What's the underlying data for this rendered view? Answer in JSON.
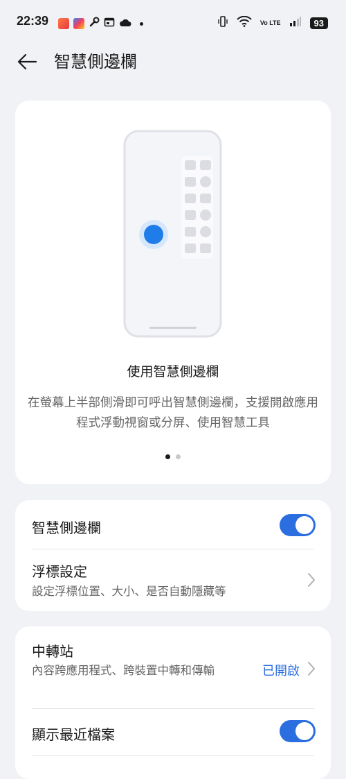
{
  "status_bar": {
    "time": "22:39",
    "network": "Vo LTE",
    "battery": "93",
    "icons": [
      "game-app-icon",
      "photo-app-icon",
      "wrench-icon",
      "calendar-icon",
      "cloud-icon",
      "dot-icon",
      "vibrate-icon",
      "wifi-icon",
      "signal-icon",
      "battery-icon"
    ]
  },
  "header": {
    "title": "智慧側邊欄"
  },
  "intro": {
    "title": "使用智慧側邊欄",
    "description": "在螢幕上半部側滑即可呼出智慧側邊欄，支援開啟應用程式浮動視窗或分屏、使用智慧工具",
    "page_dots": {
      "total": 2,
      "active": 1
    }
  },
  "settings": {
    "smart_sidebar": {
      "label": "智慧側邊欄",
      "enabled": true
    },
    "float_settings": {
      "label": "浮標設定",
      "description": "設定浮標位置、大小、是否自動隱藏等"
    }
  },
  "transfer": {
    "station": {
      "label": "中轉站",
      "description": "內容跨應用程式、跨裝置中轉和傳輸",
      "status": "已開啟"
    },
    "recent_files": {
      "label": "顯示最近檔案",
      "enabled": true
    }
  },
  "colors": {
    "accent": "#2a6ee0",
    "background": "#f1f2f5",
    "card": "#ffffff"
  }
}
